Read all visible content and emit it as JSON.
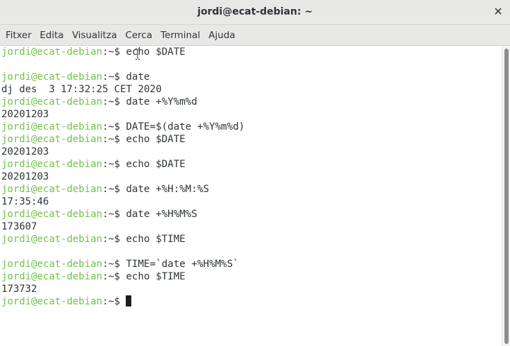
{
  "window": {
    "title": "jordi@ecat-debian: ~",
    "close_symbol": "✕"
  },
  "menubar": {
    "items": [
      "Fitxer",
      "Edita",
      "Visualitza",
      "Cerca",
      "Terminal",
      "Ajuda"
    ]
  },
  "prompt": {
    "user": "jordi@ecat-debian",
    "sep": ":",
    "path": "~",
    "sign": "$ "
  },
  "colors": {
    "prompt_user": "#73c24a",
    "text": "#2e3436",
    "background": "#ffffff"
  },
  "lines": [
    {
      "type": "cmd",
      "text": "echo $DATE"
    },
    {
      "type": "out",
      "text": ""
    },
    {
      "type": "cmd",
      "text": "date"
    },
    {
      "type": "out",
      "text": "dj des  3 17:32:25 CET 2020"
    },
    {
      "type": "cmd",
      "text": "date +%Y%m%d"
    },
    {
      "type": "out",
      "text": "20201203"
    },
    {
      "type": "cmd",
      "text": "DATE=$(date +%Y%m%d)"
    },
    {
      "type": "cmd",
      "text": "echo $DATE"
    },
    {
      "type": "out",
      "text": "20201203"
    },
    {
      "type": "cmd",
      "text": "echo $DATE"
    },
    {
      "type": "out",
      "text": "20201203"
    },
    {
      "type": "cmd",
      "text": "date +%H:%M:%S"
    },
    {
      "type": "out",
      "text": "17:35:46"
    },
    {
      "type": "cmd",
      "text": "date +%H%M%S"
    },
    {
      "type": "out",
      "text": "173607"
    },
    {
      "type": "cmd",
      "text": "echo $TIME"
    },
    {
      "type": "out",
      "text": ""
    },
    {
      "type": "cmd",
      "text": "TIME=`date +%H%M%S`"
    },
    {
      "type": "cmd",
      "text": "echo $TIME"
    },
    {
      "type": "out",
      "text": "173732"
    },
    {
      "type": "cmd",
      "text": "",
      "cursor": true
    }
  ]
}
